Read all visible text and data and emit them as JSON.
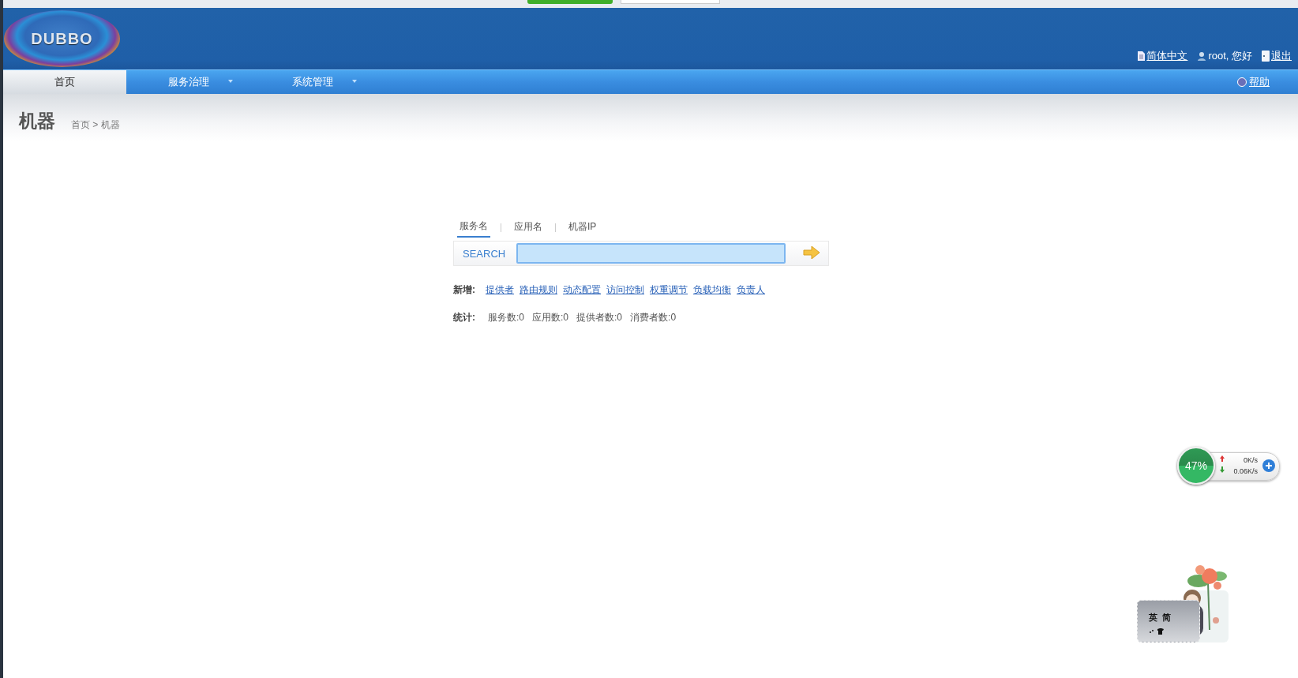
{
  "header": {
    "logo": "DUBBO",
    "links": [
      {
        "kind": "language",
        "label": "简体中文",
        "link": true
      },
      {
        "kind": "user",
        "label": "root, 您好",
        "link": false
      },
      {
        "kind": "logout",
        "label": "退出",
        "link": true
      }
    ]
  },
  "nav": {
    "items": [
      {
        "label": "首页",
        "selected": true,
        "dropdown": false
      },
      {
        "label": "服务治理",
        "selected": false,
        "dropdown": true
      },
      {
        "label": "系统管理",
        "selected": false,
        "dropdown": true
      }
    ],
    "help": "帮助"
  },
  "page": {
    "title": "机器",
    "breadcrumb": "首页 > 机器"
  },
  "search": {
    "tabs": [
      {
        "label": "服务名",
        "selected": true
      },
      {
        "label": "应用名",
        "selected": false
      },
      {
        "label": "机器IP",
        "selected": false
      }
    ],
    "label": "SEARCH"
  },
  "add": {
    "label": "新增:",
    "links": [
      "提供者",
      "路由规则",
      "动态配置",
      "访问控制",
      "权重调节",
      "负载均衡",
      "负责人"
    ]
  },
  "stats": {
    "label": "统计:",
    "items": [
      "服务数:0",
      "应用数:0",
      "提供者数:0",
      "消费者数:0"
    ]
  },
  "speed_widget": {
    "percent": "47%",
    "upload": "0K/s",
    "download": "0.06K/s"
  },
  "ime_widget": {
    "chars": [
      "英",
      "简"
    ]
  }
}
